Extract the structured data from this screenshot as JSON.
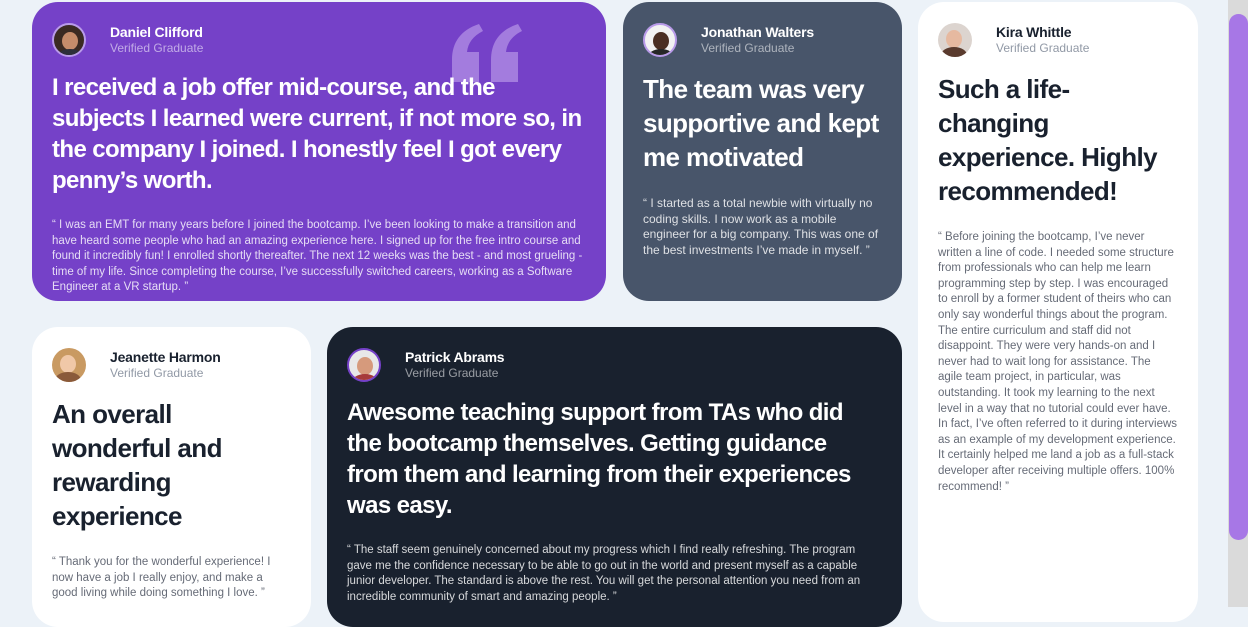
{
  "testimonials": [
    {
      "name": "Daniel Clifford",
      "role": "Verified Graduate",
      "title": "I received a job offer mid-course, and the subjects I learned were current, if not more so, in the company I joined. I honestly feel I got every penny’s worth.",
      "quote": "“ I was an EMT for many years before I joined the bootcamp. I’ve been looking to make a transition and have heard some people who had an amazing experience here. I signed up for the free intro course and found it incredibly fun! I enrolled shortly thereafter. The next 12 weeks was the best - and most grueling - time of my life. Since completing the course, I’ve successfully switched careers, working as a Software Engineer at a VR startup. ”"
    },
    {
      "name": "Jonathan Walters",
      "role": "Verified Graduate",
      "title": "The team was very supportive and kept me motivated",
      "quote": "“ I started as a total newbie with virtually no coding skills. I now work as a mobile engineer for a big company. This was one of the best investments I’ve made in myself. ”"
    },
    {
      "name": "Kira Whittle",
      "role": "Verified Graduate",
      "title": "Such a life-changing experience. Highly recommended!",
      "quote": "“ Before joining the bootcamp, I’ve never written a line of code. I needed some structure from professionals who can help me learn programming step by step. I was encouraged to enroll by a former student of theirs who can only say wonderful things about the program. The entire curriculum and staff did not disappoint. They were very hands-on and I never had to wait long for assistance. The agile team project, in particular, was outstanding. It took my learning to the next level in a way that no tutorial could ever have. In fact, I’ve often referred to it during interviews as an example of my development experience. It certainly helped me land a job as a full-stack developer after receiving multiple offers. 100% recommend! ”"
    },
    {
      "name": "Jeanette Harmon",
      "role": "Verified Graduate",
      "title": "An overall wonderful and rewarding experience",
      "quote": "“ Thank you for the wonderful experience! I now have a job I really enjoy, and make a good living while doing something I love. ”"
    },
    {
      "name": "Patrick Abrams",
      "role": "Verified Graduate",
      "title": "Awesome teaching support from TAs who did the bootcamp themselves. Getting guidance from them and learning from their experiences was easy.",
      "quote": "“ The staff seem genuinely concerned about my progress which I find really refreshing. The program gave me the confidence necessary to be able to go out in the world and present myself as a capable junior developer. The standard is above the rest. You will get the personal attention you need from an incredible community of smart and amazing people. ”"
    }
  ],
  "colors": {
    "purple": "#7541c8",
    "slate": "#48556a",
    "dark": "#19212e",
    "white": "#ffffff",
    "page_bg": "#ecf2f8"
  },
  "icons": {
    "decor": "quotation-mark-icon"
  }
}
